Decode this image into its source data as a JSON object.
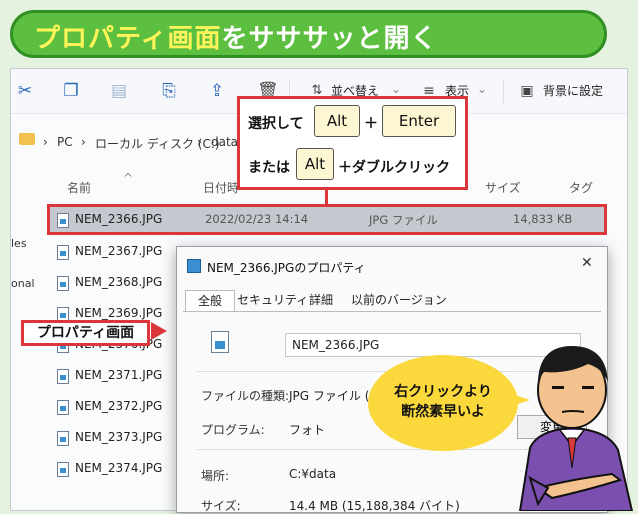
{
  "banner": {
    "highlight": "プロパティ画面",
    "rest": "をサササッと開く"
  },
  "toolbar": {
    "sort_label": "並べ替え",
    "view_label": "表示",
    "background_label": "背景に設定",
    "icons": [
      "cut-icon",
      "copy-icon",
      "paste-icon",
      "rename-icon",
      "share-icon",
      "delete-icon",
      "sort-icon",
      "view-icon",
      "background-icon"
    ]
  },
  "address": {
    "pc": "PC",
    "drive": "ローカル ディスク (C:)",
    "folder": "data",
    "sep": "›"
  },
  "columns": {
    "name": "名前",
    "date": "日付時",
    "type": "",
    "size": "サイズ",
    "tag": "タグ"
  },
  "left_fragments": [
    "les",
    "onal"
  ],
  "files": [
    {
      "name": "NEM_2366.JPG",
      "date": "2022/02/23 14:14",
      "type": "JPG ファイル",
      "size": "14,833 KB"
    },
    {
      "name": "NEM_2367.JPG",
      "date": "",
      "type": "",
      "size": ""
    },
    {
      "name": "NEM_2368.JPG",
      "date": "",
      "type": "",
      "size": ""
    },
    {
      "name": "NEM_2369.JPG",
      "date": "",
      "type": "",
      "size": ""
    },
    {
      "name": "NEM_2370.JPG",
      "date": "",
      "type": "",
      "size": ""
    },
    {
      "name": "NEM_2371.JPG",
      "date": "",
      "type": "",
      "size": ""
    },
    {
      "name": "NEM_2372.JPG",
      "date": "",
      "type": "",
      "size": ""
    },
    {
      "name": "NEM_2373.JPG",
      "date": "",
      "type": "",
      "size": ""
    },
    {
      "name": "NEM_2374.JPG",
      "date": "",
      "type": "",
      "size": ""
    }
  ],
  "hint": {
    "line1_prefix": "選択して",
    "key_alt": "Alt",
    "plus": "＋",
    "key_enter": "Enter",
    "line2_prefix": "または",
    "line2_suffix": "＋ダブルクリック"
  },
  "tag_label": "プロパティ画面",
  "dialog": {
    "title": "NEM_2366.JPGのプロパティ",
    "close": "✕",
    "tabs": [
      "全般",
      "セキュリティ",
      "詳細",
      "以前のバージョン"
    ],
    "filename": "NEM_2366.JPG",
    "type_label": "ファイルの種類:",
    "type_value": "JPG ファイル (.JPG",
    "program_label": "プログラム:",
    "program_value": "フォト",
    "change_button": "変更",
    "location_label": "場所:",
    "location_value": "C:¥data",
    "size_label": "サイズ:",
    "size_value": "14.4 MB (15,188,384 バイト)"
  },
  "bubble": {
    "line1": "右クリックより",
    "line2": "断然素早いよ"
  },
  "colors": {
    "banner_green": "#5cbf3f",
    "highlight_yellow": "#fff45a",
    "accent_red": "#d9373a",
    "bubble_yellow": "#fbd83b",
    "shirt_purple": "#7b4fb0"
  }
}
